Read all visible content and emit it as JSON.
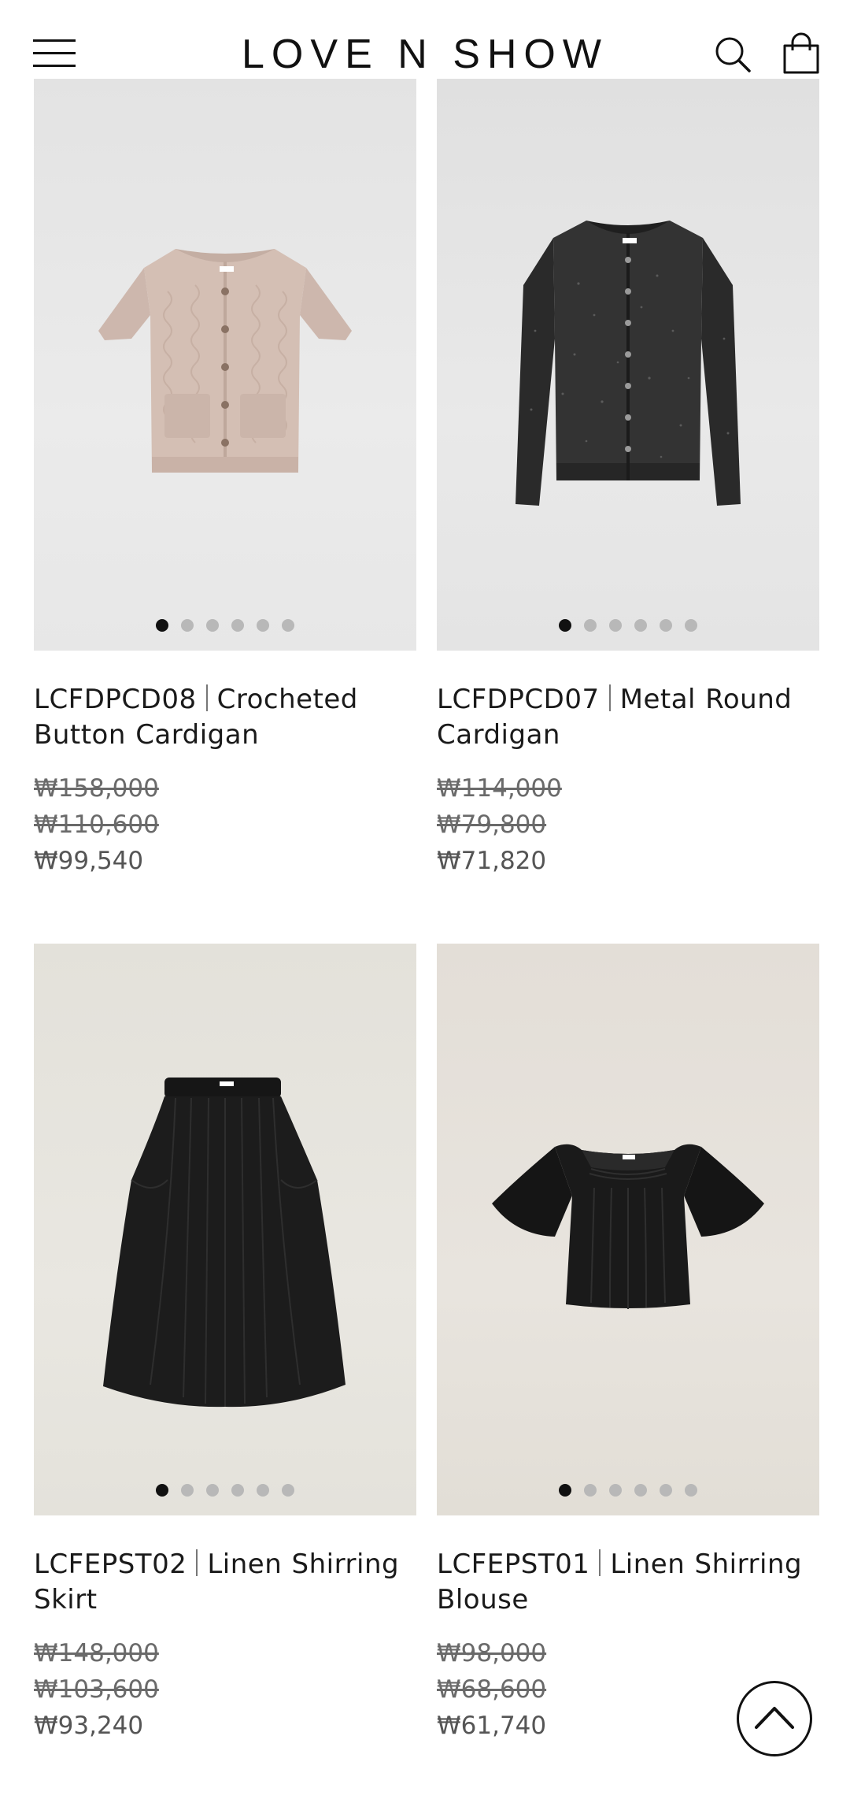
{
  "header": {
    "brand": "LOVE N SHOW",
    "menu_icon": "hamburger-menu-icon",
    "search_icon": "search-icon",
    "cart_icon": "shopping-bag-icon"
  },
  "products": [
    {
      "code": "LCFDPCD08",
      "name": "Crocheted Button Cardigan",
      "prices": [
        "₩158,000",
        "₩110,600",
        "₩99,540"
      ],
      "dots_total": 6,
      "active_dot": 1,
      "image": "pink-crochet-short-sleeve-cardigan"
    },
    {
      "code": "LCFDPCD07",
      "name": "Metal Round Cardigan",
      "prices": [
        "₩114,000",
        "₩79,800",
        "₩71,820"
      ],
      "dots_total": 6,
      "active_dot": 1,
      "image": "black-metallic-long-sleeve-cardigan"
    },
    {
      "code": "LCFEPST02",
      "name": "Linen Shirring Skirt",
      "prices": [
        "₩148,000",
        "₩103,600",
        "₩93,240"
      ],
      "dots_total": 6,
      "active_dot": 1,
      "image": "black-linen-midi-skirt"
    },
    {
      "code": "LCFEPST01",
      "name": "Linen Shirring Blouse",
      "prices": [
        "₩98,000",
        "₩68,600",
        "₩61,740"
      ],
      "dots_total": 6,
      "active_dot": 1,
      "image": "black-linen-flutter-sleeve-blouse"
    }
  ],
  "scroll_top_icon": "chevron-up-icon",
  "colors": {
    "text": "#1a1a1a",
    "price": "#555555",
    "dot_active": "#111111",
    "dot_inactive": "#b8b8b8",
    "image_bg_grey": "#e6e6e6",
    "image_bg_beige": "#e5e2da"
  }
}
